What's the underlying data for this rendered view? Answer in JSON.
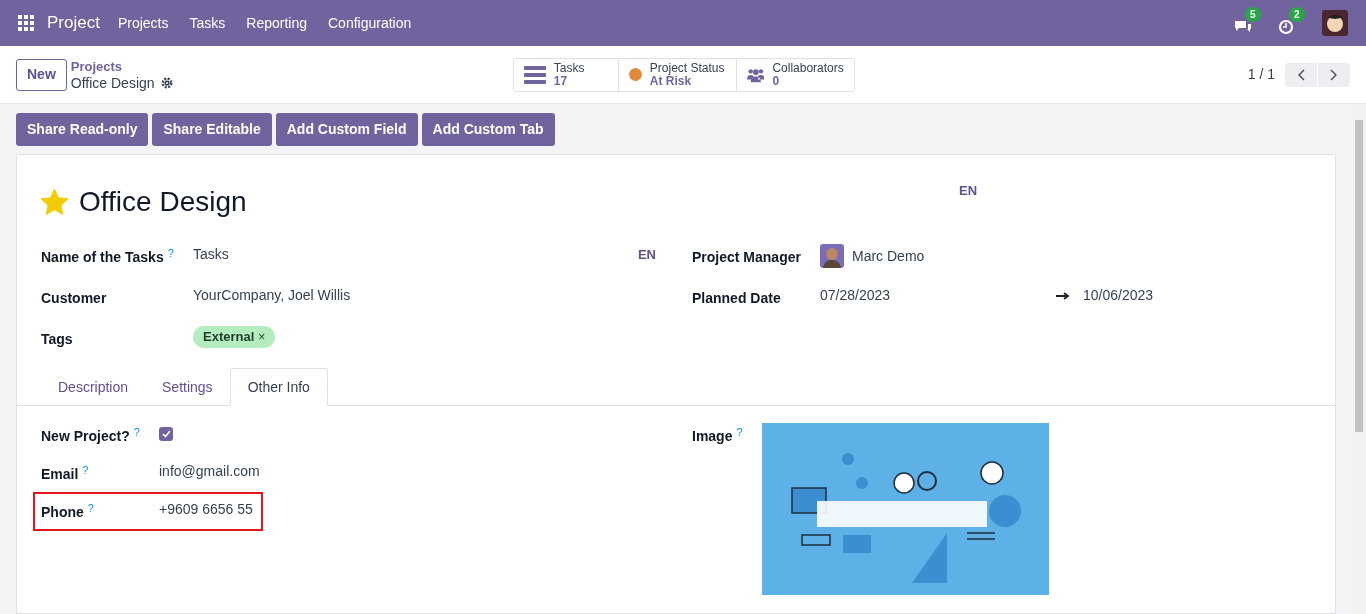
{
  "navbar": {
    "app_name": "Project",
    "menu": [
      "Projects",
      "Tasks",
      "Reporting",
      "Configuration"
    ],
    "notifications": [
      {
        "kind": "chat",
        "count": "5"
      },
      {
        "kind": "activity",
        "count": "2"
      }
    ]
  },
  "control_panel": {
    "new_button": "New",
    "breadcrumb": {
      "parent": "Projects",
      "current": "Office Design"
    },
    "smart_buttons": [
      {
        "kind": "tasks",
        "label": "Tasks",
        "value": "17"
      },
      {
        "kind": "status",
        "label": "Project Status",
        "value": "At Risk",
        "color": "#e08a3c"
      },
      {
        "kind": "collaborators",
        "label": "Collaborators",
        "value": "0"
      }
    ],
    "pager": "1 / 1"
  },
  "action_buttons": [
    "Share Read-only",
    "Share Editable",
    "Add Custom Field",
    "Add Custom Tab"
  ],
  "form": {
    "title": "Office Design",
    "favorite": true,
    "title_lang": "EN",
    "left_fields": [
      {
        "kind": "text",
        "label": "Name of the Tasks",
        "help": "?",
        "value": "Tasks",
        "lang": "EN"
      },
      {
        "kind": "text",
        "label": "Customer",
        "value": "YourCompany, Joel Willis"
      },
      {
        "kind": "tag",
        "label": "Tags",
        "value": "External",
        "remove": "×"
      }
    ],
    "right_fields": [
      {
        "kind": "avatar",
        "label": "Project Manager",
        "value": "Marc Demo"
      },
      {
        "kind": "daterange",
        "label": "Planned Date",
        "value": "07/28/2023",
        "end": "10/06/2023"
      }
    ],
    "tabs": [
      {
        "label": "Description",
        "selected": false
      },
      {
        "label": "Settings",
        "selected": false
      },
      {
        "label": "Other Info",
        "selected": true
      }
    ],
    "tab_left_fields": [
      {
        "kind": "checkbox",
        "label": "New Project?",
        "help": "?",
        "checked": true,
        "highlighted": false
      },
      {
        "kind": "text",
        "label": "Email",
        "help": "?",
        "value": "info@gmail.com",
        "highlighted": false
      },
      {
        "kind": "text",
        "label": "Phone",
        "help": "?",
        "value": "+9609 6656 55",
        "highlighted": true
      }
    ],
    "tab_right_fields": [
      {
        "label": "Image",
        "help": "?"
      }
    ]
  }
}
